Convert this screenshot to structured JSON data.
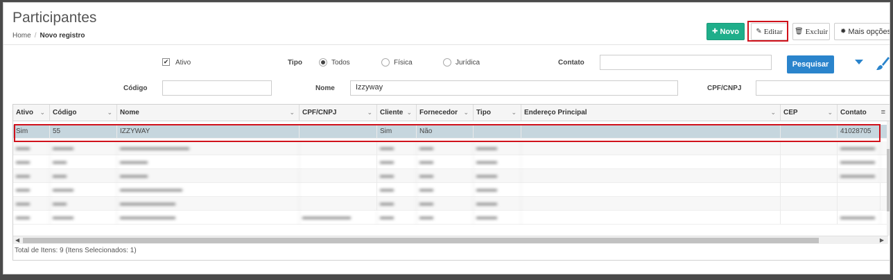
{
  "header": {
    "title": "Participantes",
    "breadcrumb_home": "Home",
    "breadcrumb_sep": "/",
    "breadcrumb_current": "Novo registro"
  },
  "toolbar": {
    "novo_label": "Novo",
    "editar_label": "Editar",
    "excluir_label": "Excluir",
    "mais_label": "Mais opções"
  },
  "filters": {
    "ativo_label": "Ativo",
    "ativo_checked": true,
    "tipo_label": "Tipo",
    "tipo_options": [
      "Todos",
      "Física",
      "Jurídica"
    ],
    "tipo_selected": "Todos",
    "contato_label": "Contato",
    "contato_value": "",
    "pesquisar_label": "Pesquisar",
    "codigo_label": "Código",
    "codigo_value": "",
    "nome_label": "Nome",
    "nome_value": "Izzyway",
    "cpf_label": "CPF/CNPJ",
    "cpf_value": ""
  },
  "grid": {
    "columns": [
      "Ativo",
      "Código",
      "Nome",
      "CPF/CNPJ",
      "Cliente",
      "Fornecedor",
      "Tipo",
      "Endereço Principal",
      "CEP",
      "Contato"
    ],
    "selected_row": {
      "ativo": "Sim",
      "codigo": "55",
      "nome": "IZZYWAY",
      "cpf": "",
      "cliente": "Sim",
      "fornecedor": "Não",
      "tipo": "",
      "endereco": "",
      "cep": "",
      "contato": "41028705"
    },
    "footer": "Total de Itens: 9 (Itens Selecionados: 1)"
  },
  "colors": {
    "novo": "#1fae8a",
    "pesquisar": "#2a84cc",
    "highlight": "#d0101a",
    "selected_row": "#c6d6de"
  }
}
